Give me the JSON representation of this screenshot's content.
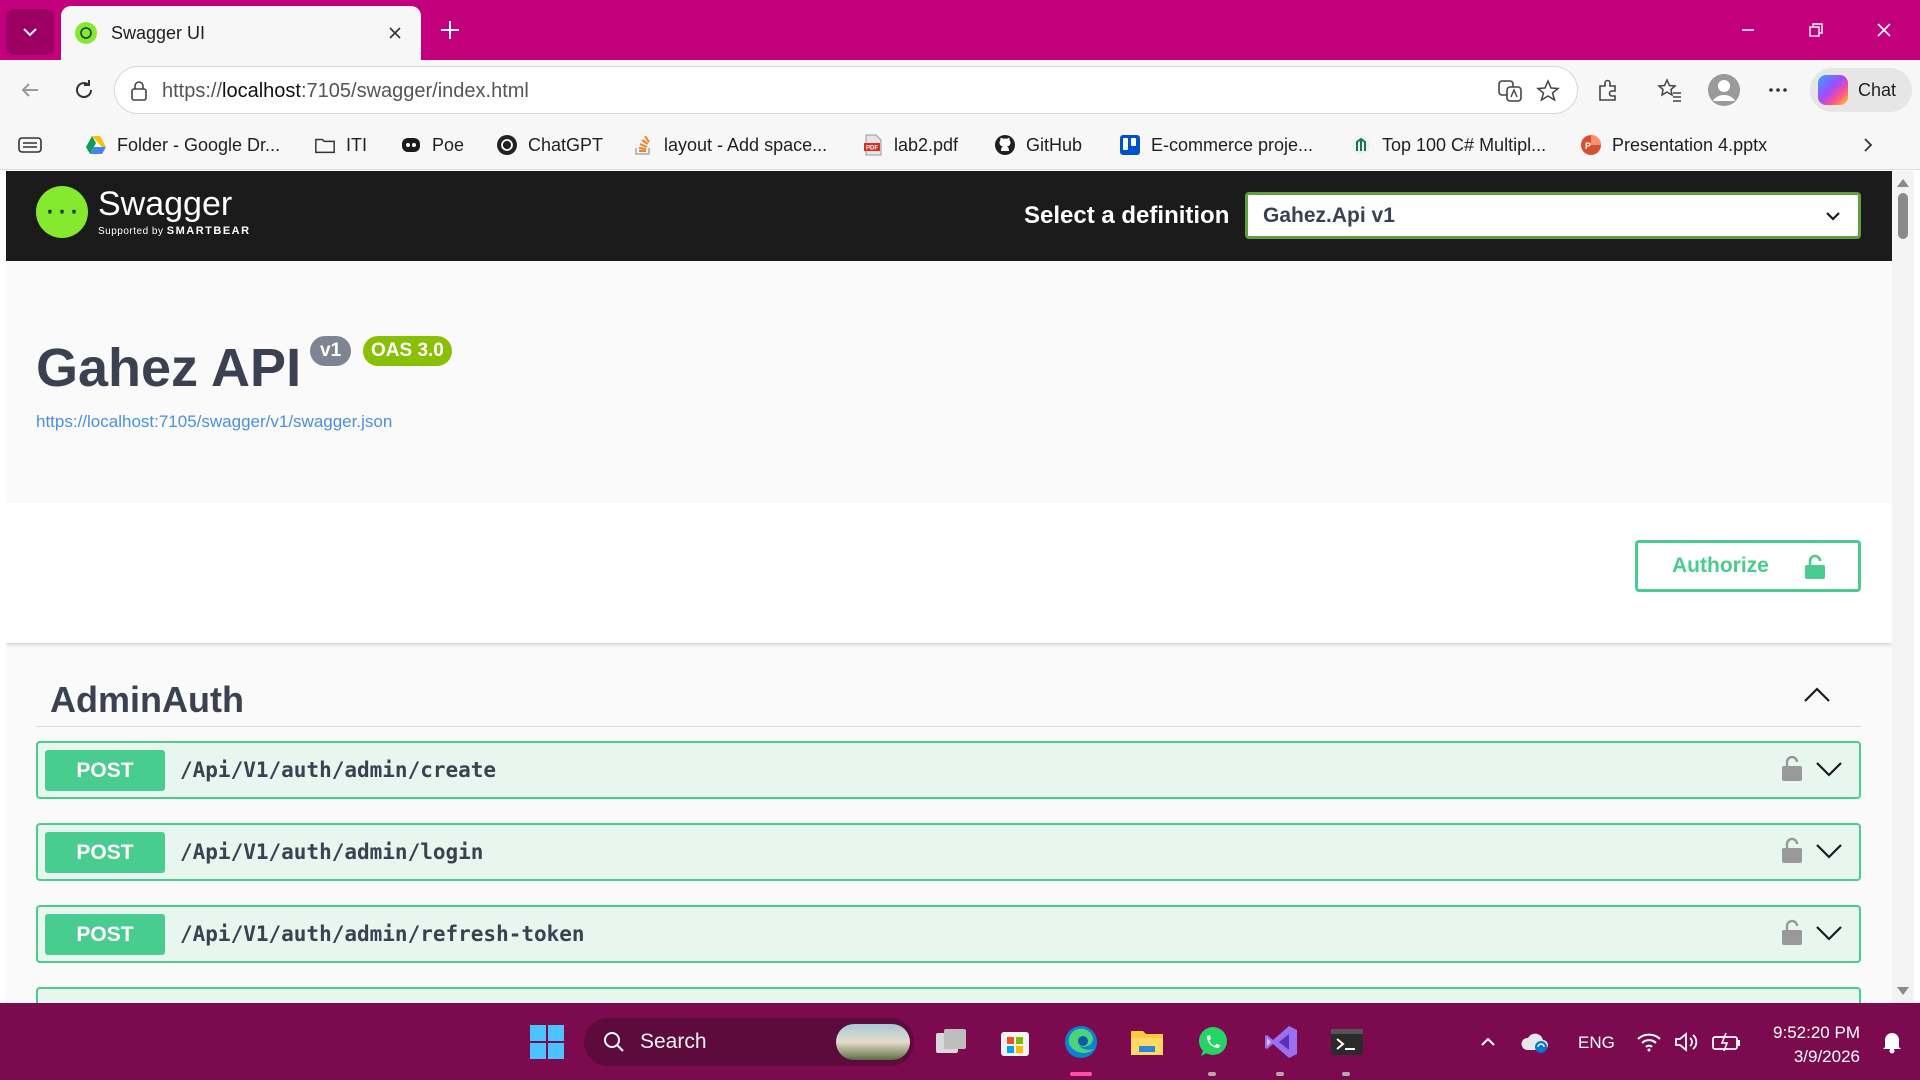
{
  "browser": {
    "tab": {
      "title": "Swagger UI"
    },
    "address": {
      "scheme": "https://",
      "host": "localhost",
      "rest": ":7105/swagger/index.html"
    },
    "chat_label": "Chat",
    "bookmarks": [
      {
        "label": "Folder - Google Dr...",
        "icon": "google-drive-icon"
      },
      {
        "label": "ITI",
        "icon": "folder-icon"
      },
      {
        "label": "Poe",
        "icon": "poe-icon"
      },
      {
        "label": "ChatGPT",
        "icon": "chatgpt-icon"
      },
      {
        "label": "layout - Add space...",
        "icon": "stackoverflow-icon"
      },
      {
        "label": "lab2.pdf",
        "icon": "pdf-icon"
      },
      {
        "label": "GitHub",
        "icon": "github-icon"
      },
      {
        "label": "E-commerce proje...",
        "icon": "trello-icon"
      },
      {
        "label": "Top 100 C# Multipl...",
        "icon": "site-icon"
      },
      {
        "label": "Presentation 4.pptx",
        "icon": "powerpoint-icon"
      }
    ]
  },
  "swagger": {
    "logo": {
      "name": "Swagger",
      "sub_prefix": "Supported by",
      "sub_brand": "SMARTBEAR"
    },
    "definition_label": "Select a definition",
    "definition_value": "Gahez.Api v1",
    "title": "Gahez API",
    "version_badge": "v1",
    "oas_badge": "OAS 3.0",
    "spec_url": "https://localhost:7105/swagger/v1/swagger.json",
    "authorize_label": "Authorize",
    "tag": "AdminAuth",
    "operations": [
      {
        "method": "POST",
        "path": "/Api/V1/auth/admin/create"
      },
      {
        "method": "POST",
        "path": "/Api/V1/auth/admin/login"
      },
      {
        "method": "POST",
        "path": "/Api/V1/auth/admin/refresh-token"
      }
    ]
  },
  "taskbar": {
    "search_label": "Search",
    "language": "ENG",
    "time": "9:52:20 PM",
    "date": "3/9/2026"
  },
  "colors": {
    "titlebar": "#c3007c",
    "taskbar": "#7c0a4f",
    "swagger_green": "#85ea2d",
    "post_green": "#49cc90",
    "select_border": "#62a03f"
  }
}
